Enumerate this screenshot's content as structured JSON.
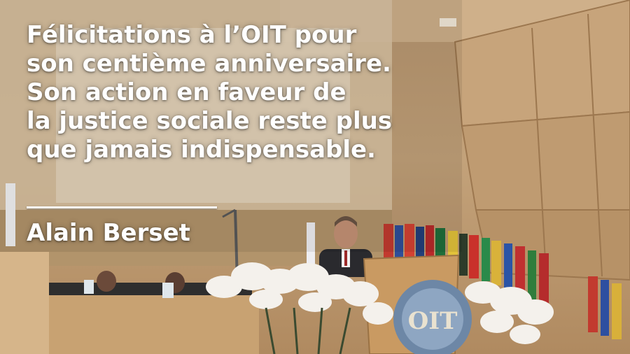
{
  "caption": {
    "quote": "Félicitations à l’OIT pour\nson centième anniversaire.\nSon action en faveur de\nla justice sociale reste plus\nque jamais indispensable.",
    "author": "Alain Berset"
  },
  "podium": {
    "emblem_text": "OIT"
  },
  "colors": {
    "caption_text": "#ffffff",
    "wood_wall": "#c3a27a",
    "podium_wood": "#c99a62",
    "orchids": "#f4f1ec"
  }
}
